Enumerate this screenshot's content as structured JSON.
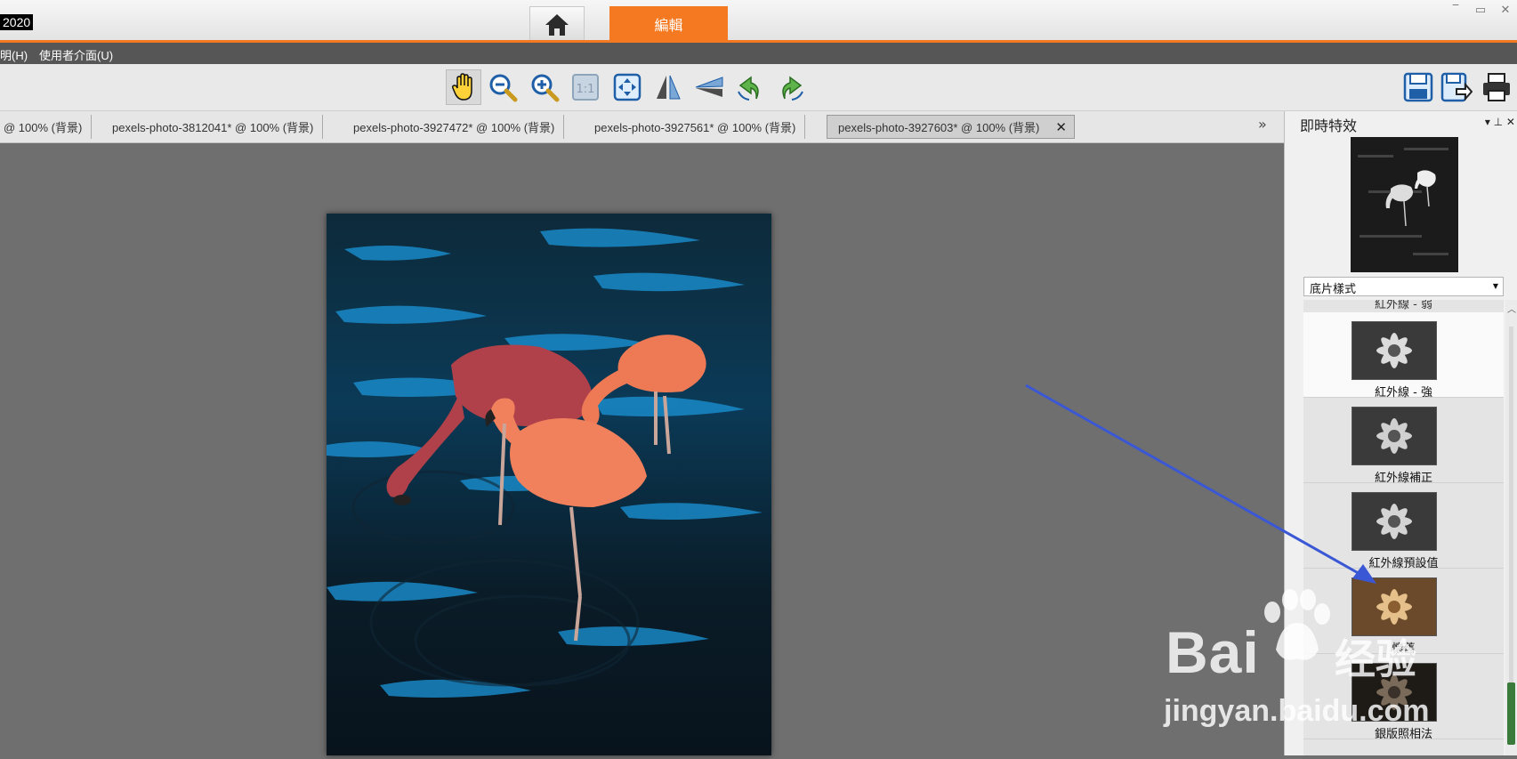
{
  "app": {
    "title": "2020"
  },
  "tabs": {
    "home_icon": "home-icon",
    "edit": "編輯"
  },
  "window": {
    "minimize": "‾",
    "restore": "▭",
    "close": "✕"
  },
  "menu": {
    "items": [
      "明(H)",
      "使用者介面(U)"
    ]
  },
  "toolbar": {
    "icons": [
      "hand-icon",
      "zoom-out-icon",
      "zoom-in-icon",
      "actual-size-icon",
      "fit-window-icon",
      "flip-vertical-icon",
      "flip-horizontal-icon",
      "rotate-left-icon",
      "rotate-right-icon",
      "save-icon",
      "save-as-icon",
      "print-icon"
    ],
    "actual_size_label": "1:1"
  },
  "doc_tabs": [
    {
      "label": "@ 100% (背景)"
    },
    {
      "label": "pexels-photo-3812041* @ 100% (背景)"
    },
    {
      "label": "pexels-photo-3927472* @ 100% (背景)"
    },
    {
      "label": "pexels-photo-3927561* @ 100% (背景)"
    },
    {
      "label": "pexels-photo-3927603* @ 100% (背景)",
      "active": true
    }
  ],
  "tab_close": "✕",
  "tab_scroll": "»",
  "panel": {
    "title": "即時特效",
    "pin": "▾  ⊥  ✕",
    "dropdown_value": "底片樣式",
    "clipped_label": "紅外線 - 弱",
    "effects": [
      {
        "label": "紅外線 - 強",
        "tone": "bw",
        "selected": true
      },
      {
        "label": "紅外線補正",
        "tone": "bw"
      },
      {
        "label": "紅外線預設值",
        "tone": "bw"
      },
      {
        "label": "懷舊",
        "tone": "sepia"
      },
      {
        "label": "銀版照相法",
        "tone": "dark"
      }
    ]
  },
  "watermark": {
    "brand": "Bai",
    "brand2": "经验",
    "url": "jingyan.baidu.com"
  },
  "colors": {
    "accent": "#f47920",
    "arrow": "#3a57d6"
  }
}
